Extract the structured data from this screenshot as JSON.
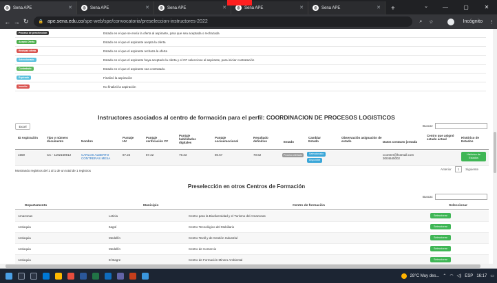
{
  "browser": {
    "tabs": [
      {
        "title": "Sena APE",
        "active": true
      },
      {
        "title": "Sena APE",
        "active": false
      },
      {
        "title": "Sena APE",
        "active": false
      },
      {
        "title": "Sena APE",
        "active": false
      },
      {
        "title": "Sena APE",
        "active": false
      }
    ],
    "new_tab": "+",
    "url_host": "ape.sena.edu.co",
    "url_path": "/spe-web/spe/convocatoria/preseleccion-instructores-2022",
    "profile_label": "Incógnito"
  },
  "legend": [
    {
      "badge": "Proceso de preselección",
      "color": "#3b3b3b",
      "desc": "Estado en el que se envía la oferta al aspirante, para que sea aceptada o rechazada"
    },
    {
      "badge": "Aceptó Oferta",
      "color": "#4cae4c",
      "desc": "Estado en el que el aspirante acepta la oferta"
    },
    {
      "badge": "Rechazó oferta",
      "color": "#d9534f",
      "desc": "Estado en el que el aspirante rechaza la oferta"
    },
    {
      "badge": "Seleccionado",
      "color": "#5bc0de",
      "desc": "Estado en el que el aspirante haya aceptado la oferta y el CF seleccione al aspirante, para iniciar contratación"
    },
    {
      "badge": "Contratado",
      "color": "#5cb85c",
      "desc": "Estado en el que el aspirante sea contratado."
    },
    {
      "badge": "Expirado",
      "color": "#5bc0de",
      "desc": "Finalizó la aspiración"
    },
    {
      "badge": "Inscrito",
      "color": "#d9534f",
      "desc": "No finalizó la aspiración"
    }
  ],
  "instructores": {
    "title": "Instructores asociados al centro de formación para el perfil: COORDINACION DE PROCESOS LOGISTICOS",
    "excel_label": "Excel",
    "search_label": "Buscar:",
    "columns": [
      "ID Aspiración",
      "Tipo y número documento",
      "Nombre",
      "Puntaje HV",
      "Puntaje verificación CF",
      "Puntaje habilidades digitales",
      "Puntaje socioemocional",
      "Resultado definitivo",
      "Estado",
      "Cambiar Estado",
      "Observación asignación de estado",
      "Datos contacto jornada",
      "Centro que asignó estado actual",
      "Histórico de Estados"
    ],
    "row": {
      "id": "1559",
      "documento": "CC - 1192168912",
      "nombre": "CARLOS ALBERTO CONTRERAS MESA",
      "hv": "87.22",
      "verificacion": "87.22",
      "digitales": "79.33",
      "socioemocional": "80.67",
      "resultado": "70.62",
      "estado": "Proceso ofertado",
      "cambiar_1": "Seleccionado",
      "cambiar_2": "Disponible",
      "contacto_1": "ccontrer@hotmail.com",
      "contacto_2": "3004645002",
      "historico_btn": "Histórico de Estados"
    },
    "showing": "Mostrando registros del 1 al 1 de un total de 1 registros",
    "prev": "Anterior",
    "page": "1",
    "next": "Siguiente"
  },
  "preseleccion": {
    "title": "Preselección en otros Centros de Formación",
    "search_label": "Buscar:",
    "columns": [
      "Departamento",
      "Municipio",
      "Centro de formación",
      "Seleccionar"
    ],
    "button_label": "Seleccionar",
    "rows": [
      {
        "departamento": "Amazonas",
        "municipio": "Leticia",
        "centro": "Centro para la Biodiversidad y el Turismo del Amazonas"
      },
      {
        "departamento": "Antioquia",
        "municipio": "Itagüí",
        "centro": "Centro Tecnológico del Mobiliario"
      },
      {
        "departamento": "Antioquia",
        "municipio": "Medellín",
        "centro": "Centro Textil y de Gestión Industrial"
      },
      {
        "departamento": "Antioquia",
        "municipio": "Medellín",
        "centro": "Centro de Comercio"
      },
      {
        "departamento": "Antioquia",
        "municipio": "El Bagre",
        "centro": "Centro de Formación Minero Ambiental"
      }
    ]
  },
  "taskbar": {
    "weather": "28°C Muy des...",
    "lang": "ESP",
    "time": "16:17"
  }
}
